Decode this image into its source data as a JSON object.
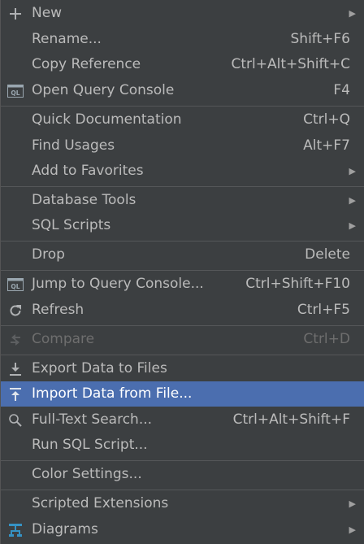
{
  "menu": {
    "items": [
      {
        "id": "new",
        "label": "New",
        "shortcut": "",
        "submenu": true,
        "icon": "plus-icon"
      },
      {
        "id": "rename",
        "label": "Rename...",
        "shortcut": "Shift+F6",
        "submenu": false,
        "icon": ""
      },
      {
        "id": "copy-reference",
        "label": "Copy Reference",
        "shortcut": "Ctrl+Alt+Shift+C",
        "submenu": false,
        "icon": ""
      },
      {
        "id": "open-query-console",
        "label": "Open Query Console",
        "shortcut": "F4",
        "submenu": false,
        "icon": "ql-console-icon"
      },
      {
        "id": "quick-documentation",
        "label": "Quick Documentation",
        "shortcut": "Ctrl+Q",
        "submenu": false,
        "icon": ""
      },
      {
        "id": "find-usages",
        "label": "Find Usages",
        "shortcut": "Alt+F7",
        "submenu": false,
        "icon": ""
      },
      {
        "id": "add-to-favorites",
        "label": "Add to Favorites",
        "shortcut": "",
        "submenu": true,
        "icon": ""
      },
      {
        "id": "database-tools",
        "label": "Database Tools",
        "shortcut": "",
        "submenu": true,
        "icon": ""
      },
      {
        "id": "sql-scripts",
        "label": "SQL Scripts",
        "shortcut": "",
        "submenu": true,
        "icon": ""
      },
      {
        "id": "drop",
        "label": "Drop",
        "shortcut": "Delete",
        "submenu": false,
        "icon": ""
      },
      {
        "id": "jump-to-query-console",
        "label": "Jump to Query Console...",
        "shortcut": "Ctrl+Shift+F10",
        "submenu": false,
        "icon": "ql-console-icon"
      },
      {
        "id": "refresh",
        "label": "Refresh",
        "shortcut": "Ctrl+F5",
        "submenu": false,
        "icon": "refresh-icon"
      },
      {
        "id": "compare",
        "label": "Compare",
        "shortcut": "Ctrl+D",
        "submenu": false,
        "icon": "compare-icon",
        "disabled": true
      },
      {
        "id": "export-data-to-files",
        "label": "Export Data to Files",
        "shortcut": "",
        "submenu": false,
        "icon": "export-icon"
      },
      {
        "id": "import-data-from-file",
        "label": "Import Data from File...",
        "shortcut": "",
        "submenu": false,
        "icon": "import-icon",
        "selected": true
      },
      {
        "id": "full-text-search",
        "label": "Full-Text Search...",
        "shortcut": "Ctrl+Alt+Shift+F",
        "submenu": false,
        "icon": "search-icon"
      },
      {
        "id": "run-sql-script",
        "label": "Run SQL Script...",
        "shortcut": "",
        "submenu": false,
        "icon": ""
      },
      {
        "id": "color-settings",
        "label": "Color Settings...",
        "shortcut": "",
        "submenu": false,
        "icon": ""
      },
      {
        "id": "scripted-extensions",
        "label": "Scripted Extensions",
        "shortcut": "",
        "submenu": true,
        "icon": ""
      },
      {
        "id": "diagrams",
        "label": "Diagrams",
        "shortcut": "",
        "submenu": true,
        "icon": "diagram-icon"
      }
    ]
  },
  "colors": {
    "background": "#3c3f41",
    "text": "#bbbbbb",
    "disabled_text": "#6e6e6e",
    "selection": "#4b6eaf",
    "separator": "#555759",
    "console_icon_accent": "#9aa7b0",
    "diagram_icon_accent": "#3592c4"
  },
  "submenu_arrow": "▶"
}
